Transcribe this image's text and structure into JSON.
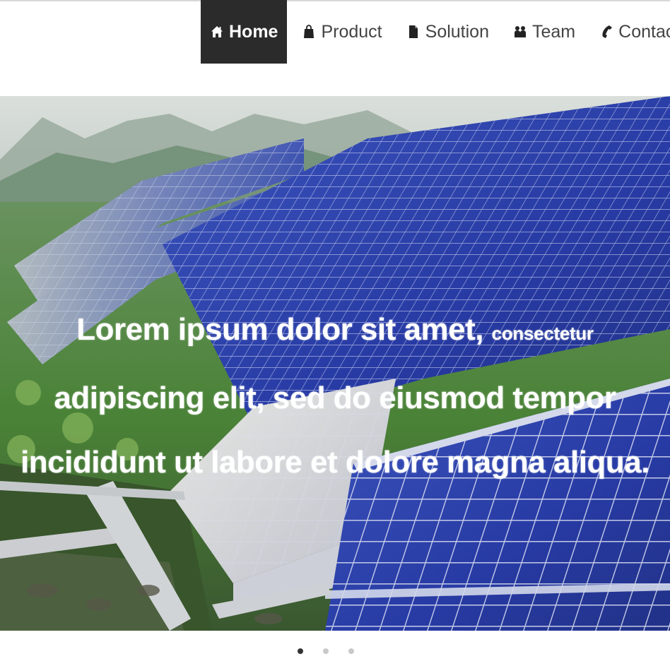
{
  "nav": {
    "items": [
      {
        "label": "Home",
        "icon": "home-icon",
        "active": true
      },
      {
        "label": "Product",
        "icon": "shopping-bag-icon",
        "active": false
      },
      {
        "label": "Solution",
        "icon": "file-icon",
        "active": false
      },
      {
        "label": "Team",
        "icon": "team-icon",
        "active": false
      },
      {
        "label": "Contact",
        "icon": "phone-icon",
        "active": false
      }
    ]
  },
  "hero": {
    "line1_main": "Lorem ipsum dolor sit amet, ",
    "line1_small": "consectetur",
    "line2": "adipiscing elit, sed do eiusmod tempor",
    "line3": "incididunt ut labore et dolore magna aliqua."
  },
  "carousel": {
    "slide_count": 3,
    "active_index": 0
  },
  "colors": {
    "nav_active_bg": "#2b2b2b",
    "nav_text": "#444444",
    "dot_active": "#333333",
    "dot_inactive": "#c9c9c9"
  }
}
